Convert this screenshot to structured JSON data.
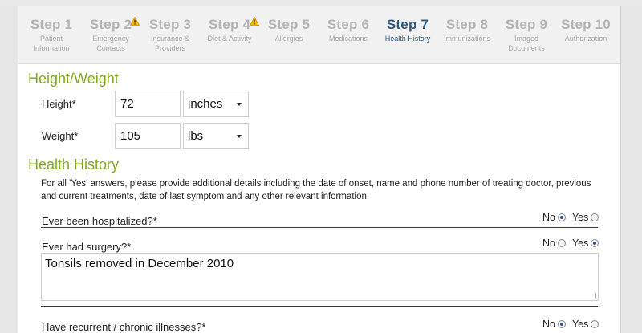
{
  "steps": [
    {
      "num": "Step 1",
      "sub1": "Patient",
      "sub2": "Information",
      "warning": false,
      "active": false
    },
    {
      "num": "Step 2",
      "sub1": "Emergency",
      "sub2": "Contacts",
      "warning": true,
      "active": false
    },
    {
      "num": "Step 3",
      "sub1": "Insurance &",
      "sub2": "Providers",
      "warning": false,
      "active": false
    },
    {
      "num": "Step 4",
      "sub1": "Diet & Activity",
      "sub2": "",
      "warning": true,
      "active": false
    },
    {
      "num": "Step 5",
      "sub1": "Allergies",
      "sub2": "",
      "warning": false,
      "active": false
    },
    {
      "num": "Step 6",
      "sub1": "Medications",
      "sub2": "",
      "warning": false,
      "active": false
    },
    {
      "num": "Step 7",
      "sub1": "Health History",
      "sub2": "",
      "warning": false,
      "active": true
    },
    {
      "num": "Step 8",
      "sub1": "Immunizations",
      "sub2": "",
      "warning": false,
      "active": false
    },
    {
      "num": "Step 9",
      "sub1": "Imaged",
      "sub2": "Documents",
      "warning": false,
      "active": false
    },
    {
      "num": "Step 10",
      "sub1": "Authorization",
      "sub2": "",
      "warning": false,
      "active": false
    }
  ],
  "height_weight": {
    "title": "Height/Weight",
    "height_label": "Height*",
    "height_value": "72",
    "height_unit": "inches",
    "weight_label": "Weight*",
    "weight_value": "105",
    "weight_unit": "lbs"
  },
  "health_history": {
    "title": "Health History",
    "info": "For all 'Yes' answers, please provide additional details including the date of onset, name and phone number of treating doctor, previous and current treatments, date of last symptom and any other relevant information.",
    "no_label": "No",
    "yes_label": "Yes",
    "questions": [
      {
        "label": "Ever been hospitalized?*",
        "answer": "No"
      },
      {
        "label": "Ever had surgery?*",
        "answer": "Yes",
        "details": "Tonsils removed in December 2010"
      },
      {
        "label": "Have recurrent / chronic illnesses?*",
        "answer": "No"
      }
    ]
  },
  "colors": {
    "section_title": "#7eaa1c",
    "active_step": "#2d5b85",
    "inactive_step": "#b4b4b4",
    "warning": "#f5b800"
  }
}
